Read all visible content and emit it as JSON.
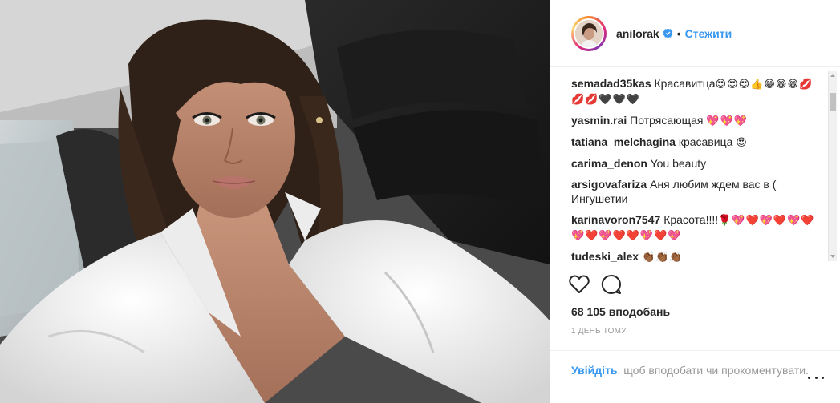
{
  "post": {
    "author": {
      "username": "anilorak",
      "verified": true
    },
    "follow_label": "Стежити",
    "separator": "•",
    "comments": [
      {
        "user": "semadad35kas",
        "text": "Красавитца",
        "emoji": "😍😍😍👍😁😁😁💋💋💋🖤🖤🖤"
      },
      {
        "user": "yasmin.rai",
        "text": "Потрясающая",
        "emoji": "💖💖💖"
      },
      {
        "user": "tatiana_melchagina",
        "text": "красавица",
        "emoji": "😍"
      },
      {
        "user": "carima_denon",
        "text": "You beauty",
        "emoji": ""
      },
      {
        "user": "arsigovafariza",
        "text": "Аня любим ждем вас в ( Ингушетии",
        "emoji": ""
      },
      {
        "user": "karinavoron7547",
        "text": "Красота!!!!",
        "emoji": "🌹💖❤️💖❤️💖❤️💖❤️💖❤️❤️💖❤️💖"
      },
      {
        "user": "tudeski_alex",
        "text": "",
        "emoji": "👏🏾👏🏾👏🏾"
      }
    ],
    "likes_label": "68 105 вподобань",
    "time_label": "1 день тому",
    "login_link": "Увійдіть",
    "login_text": ", щоб вподобати чи прокоментувати."
  },
  "icons": {
    "like": "heart-outline-icon",
    "comment": "speech-bubble-icon",
    "verified": "verified-badge-icon",
    "more": "more-options-icon"
  },
  "colors": {
    "link": "#3897f0",
    "text": "#262626",
    "muted": "#999999",
    "border": "#efefef"
  }
}
